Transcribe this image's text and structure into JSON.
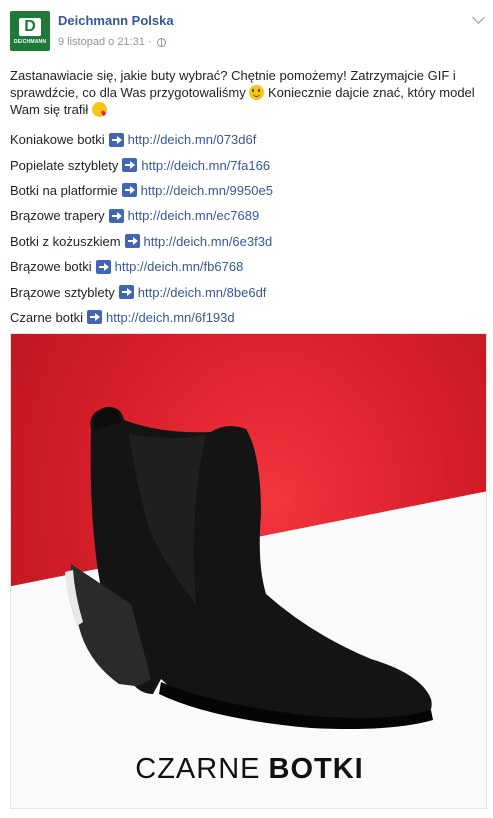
{
  "page": {
    "name": "Deichmann Polska",
    "logo_text": "DEICHMANN",
    "logo_letter": "D",
    "timestamp": "9 listopad o 21:31",
    "separator": "·"
  },
  "post": {
    "text_part1": "Zastanawiacie się, jakie buty wybrać? Chętnie pomożemy! Zatrzymajcie GIF i sprawdźcie, co dla Was przygotowaliśmy",
    "text_part2": "Koniecznie dajcie znać, który model Wam się trafił",
    "emoji_1": "smile-emoji",
    "emoji_2": "kiss-emoji"
  },
  "links": [
    {
      "label": "Koniakowe botki",
      "url": "http://deich.mn/073d6f"
    },
    {
      "label": "Popielate sztyblety",
      "url": "http://deich.mn/7fa166"
    },
    {
      "label": "Botki na platformie",
      "url": "http://deich.mn/9950e5"
    },
    {
      "label": "Brązowe trapery",
      "url": "http://deich.mn/ec7689"
    },
    {
      "label": "Botki z kożuszkiem",
      "url": "http://deich.mn/6e3f3d"
    },
    {
      "label": "Brązowe botki",
      "url": "http://deich.mn/fb6768"
    },
    {
      "label": "Brązowe sztyblety",
      "url": "http://deich.mn/8be6df"
    },
    {
      "label": "Czarne botki",
      "url": "http://deich.mn/6f193d"
    }
  ],
  "image": {
    "caption_thin": "CZARNE",
    "caption_bold": "BOTKI"
  },
  "colors": {
    "link": "#365899",
    "brand_green": "#1f7a3a",
    "arrow_blue": "#4267b2",
    "background_red": "#d81f2a"
  }
}
